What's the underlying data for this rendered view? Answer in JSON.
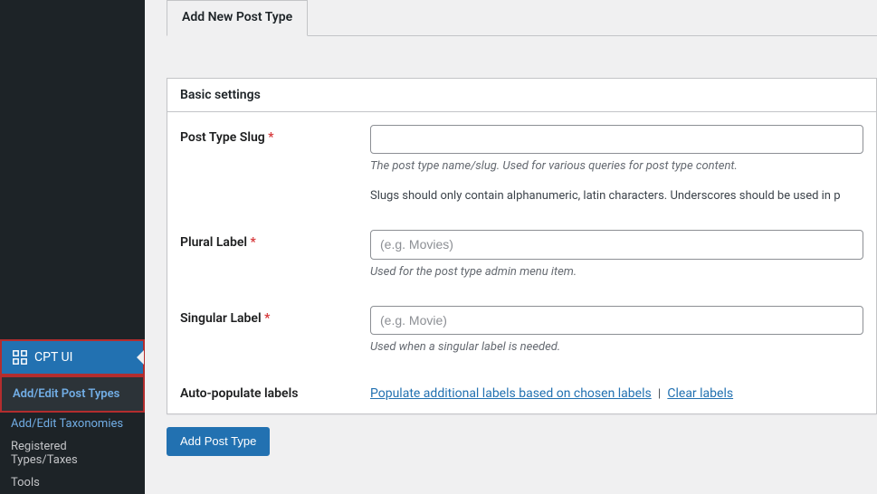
{
  "sidebar": {
    "current": {
      "label": "CPT UI"
    },
    "submenu": [
      {
        "label": "Add/Edit Post Types",
        "active": true
      },
      {
        "label": "Add/Edit Taxonomies"
      },
      {
        "label": "Registered Types/Taxes"
      },
      {
        "label": "Tools"
      }
    ]
  },
  "tabs": {
    "active": "Add New Post Type"
  },
  "panel": {
    "heading": "Basic settings"
  },
  "fields": {
    "slug": {
      "label": "Post Type Slug",
      "required": "*",
      "value": "",
      "help": "The post type name/slug. Used for various queries for post type content.",
      "help2": "Slugs should only contain alphanumeric, latin characters. Underscores should be used in p"
    },
    "plural": {
      "label": "Plural Label",
      "required": "*",
      "placeholder": "(e.g. Movies)",
      "value": "",
      "help": "Used for the post type admin menu item."
    },
    "singular": {
      "label": "Singular Label",
      "required": "*",
      "placeholder": "(e.g. Movie)",
      "value": "",
      "help": "Used when a singular label is needed."
    },
    "autopopulate": {
      "label": "Auto-populate labels",
      "link1": "Populate additional labels based on chosen labels",
      "sep": "|",
      "link2": "Clear labels"
    }
  },
  "actions": {
    "submit": "Add Post Type"
  }
}
